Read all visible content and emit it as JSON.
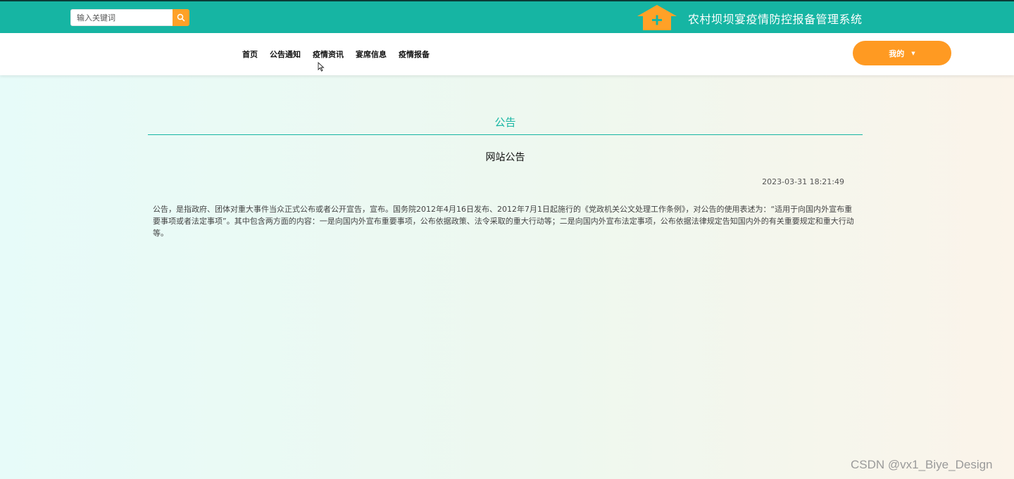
{
  "header": {
    "search_placeholder": "输入关键词",
    "search_icon": "search-icon",
    "logo_icon": "house-plus-icon",
    "site_title": "农村坝坝宴疫情防控报备管理系统",
    "colors": {
      "primary": "#16b5a3",
      "accent": "#ffa127"
    }
  },
  "nav": {
    "items": [
      "首页",
      "公告通知",
      "疫情资讯",
      "宴席信息",
      "疫情报备"
    ]
  },
  "user_menu": {
    "label": "我的",
    "caret_icon": "caret-down-icon"
  },
  "notice": {
    "section_title": "公告",
    "title": "网站公告",
    "datetime": "2023-03-31 18:21:49",
    "body": "公告，是指政府、团体对重大事件当众正式公布或者公开宣告，宣布。国务院2012年4月16日发布、2012年7月1日起施行的《党政机关公文处理工作条例》，对公告的使用表述为：“适用于向国内外宣布重要事项或者法定事项”。其中包含两方面的内容：一是向国内外宣布重要事项，公布依据政策、法令采取的重大行动等；二是向国内外宣布法定事项，公布依据法律规定告知国内外的有关重要规定和重大行动等。"
  },
  "watermark": "CSDN @vx1_Biye_Design"
}
